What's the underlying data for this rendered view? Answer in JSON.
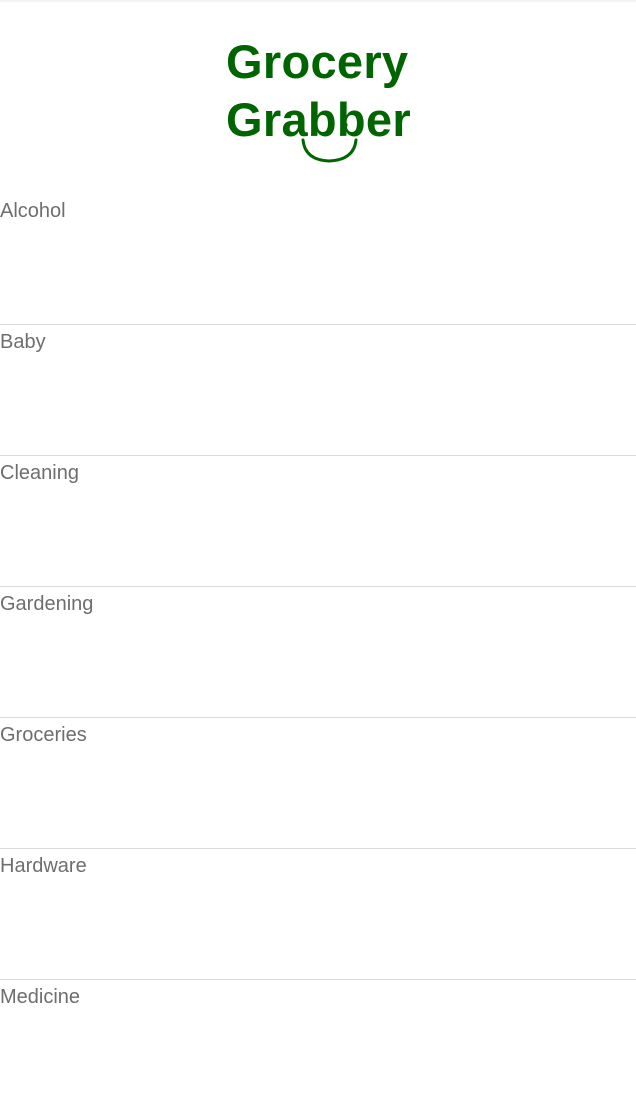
{
  "theme": {
    "brand_color": "#006400",
    "label_color": "#6e6e6e",
    "divider_color": "#d9d9d9"
  },
  "logo": {
    "line1": "Grocery",
    "line2": "Grabber",
    "smile_icon": "smile-icon"
  },
  "categories": [
    {
      "label": "Alcohol"
    },
    {
      "label": "Baby"
    },
    {
      "label": "Cleaning"
    },
    {
      "label": "Gardening"
    },
    {
      "label": "Groceries"
    },
    {
      "label": "Hardware"
    },
    {
      "label": "Medicine"
    }
  ]
}
